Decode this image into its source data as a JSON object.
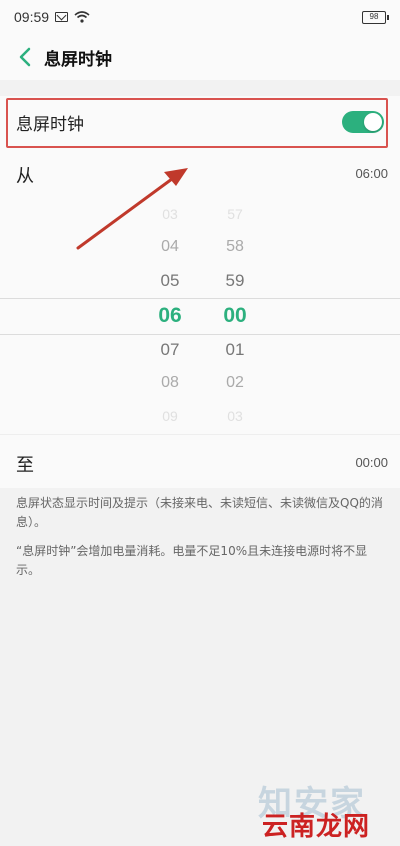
{
  "status_bar": {
    "time": "09:59",
    "battery": "98"
  },
  "header": {
    "title": "息屏时钟"
  },
  "toggle": {
    "label": "息屏时钟",
    "enabled": true
  },
  "from": {
    "label": "从",
    "value": "06:00"
  },
  "picker": {
    "hours": [
      "03",
      "04",
      "05",
      "06",
      "07",
      "08",
      "09"
    ],
    "minutes": [
      "57",
      "58",
      "59",
      "00",
      "01",
      "02",
      "03"
    ],
    "selected_hour": "06",
    "selected_minute": "00"
  },
  "to": {
    "label": "至",
    "value": "00:00"
  },
  "description": {
    "line1": "息屏状态显示时间及提示（未接来电、未读短信、未读微信及QQ的消息）。",
    "line2": "“息屏时钟”会增加电量消耗。电量不足10%且未连接电源时将不显示。"
  },
  "watermark": {
    "text1": "知安家",
    "text2": "云南龙网"
  },
  "colors": {
    "accent": "#2cb07e",
    "highlight": "#d9534f",
    "back_arrow": "#2cb07e"
  }
}
